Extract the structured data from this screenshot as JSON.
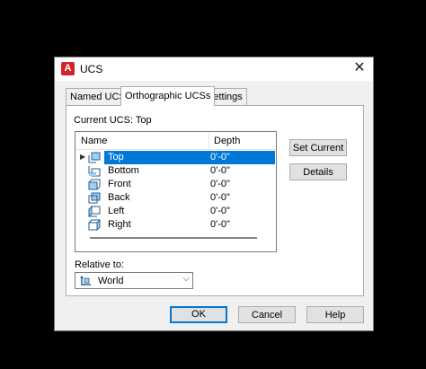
{
  "dialog": {
    "title": "UCS"
  },
  "tabs": [
    {
      "label": "Named UCSs"
    },
    {
      "label": "Orthographic UCSs"
    },
    {
      "label": "Settings"
    }
  ],
  "current_ucs": "Current UCS:  Top",
  "list": {
    "columns": {
      "name": "Name",
      "depth": "Depth"
    },
    "rows": [
      {
        "name": "Top",
        "depth": "0'-0\""
      },
      {
        "name": "Bottom",
        "depth": "0'-0\""
      },
      {
        "name": "Front",
        "depth": "0'-0\""
      },
      {
        "name": "Back",
        "depth": "0'-0\""
      },
      {
        "name": "Left",
        "depth": "0'-0\""
      },
      {
        "name": "Right",
        "depth": "0'-0\""
      }
    ]
  },
  "side_buttons": {
    "set_current": "Set Current",
    "details": "Details"
  },
  "relative_to": {
    "label": "Relative to:",
    "value": "World"
  },
  "footer": {
    "ok": "OK",
    "cancel": "Cancel",
    "help": "Help"
  }
}
